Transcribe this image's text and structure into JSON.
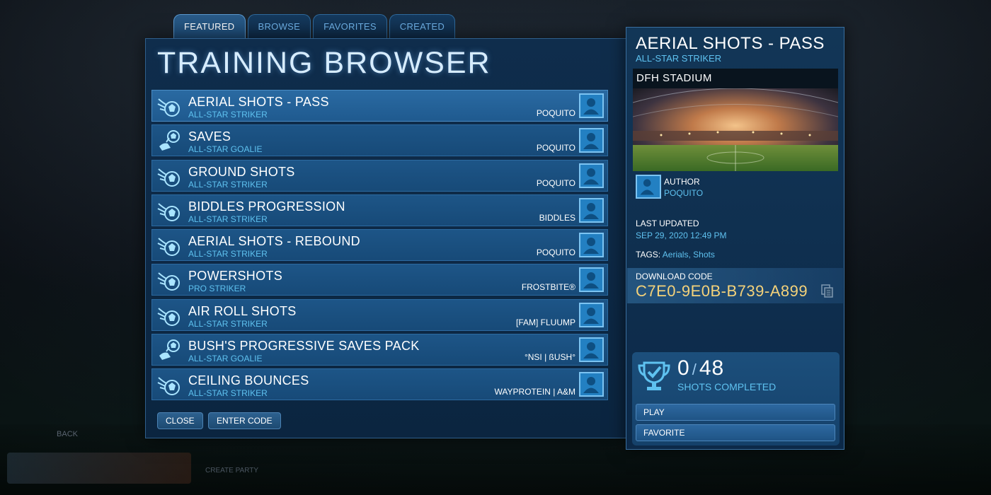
{
  "tabs": [
    {
      "label": "FEATURED",
      "active": true
    },
    {
      "label": "BROWSE",
      "active": false
    },
    {
      "label": "FAVORITES",
      "active": false
    },
    {
      "label": "CREATED",
      "active": false
    }
  ],
  "main": {
    "title": "TRAINING BROWSER",
    "rows": [
      {
        "name": "AERIAL SHOTS - PASS",
        "difficulty": "ALL-STAR STRIKER",
        "author": "POQUITO",
        "icon": "striker-icon"
      },
      {
        "name": "SAVES",
        "difficulty": "ALL-STAR GOALIE",
        "author": "POQUITO",
        "icon": "goalie-icon"
      },
      {
        "name": "GROUND SHOTS",
        "difficulty": "ALL-STAR STRIKER",
        "author": "POQUITO",
        "icon": "striker-icon"
      },
      {
        "name": "BIDDLES PROGRESSION",
        "difficulty": "ALL-STAR STRIKER",
        "author": "BIDDLES",
        "icon": "striker-icon"
      },
      {
        "name": "AERIAL SHOTS - REBOUND",
        "difficulty": "ALL-STAR STRIKER",
        "author": "POQUITO",
        "icon": "striker-icon"
      },
      {
        "name": "POWERSHOTS",
        "difficulty": "PRO STRIKER",
        "author": "FROSTBITE®",
        "icon": "striker-icon"
      },
      {
        "name": "AIR ROLL SHOTS",
        "difficulty": "ALL-STAR STRIKER",
        "author": "[FAM] FLUUMP",
        "icon": "striker-icon"
      },
      {
        "name": "BUSH'S PROGRESSIVE SAVES PACK",
        "difficulty": "ALL-STAR GOALIE",
        "author": "°NSI | ßUSH°",
        "icon": "goalie-icon"
      },
      {
        "name": "CEILING BOUNCES",
        "difficulty": "ALL-STAR STRIKER",
        "author": "WAYPROTEIN | A&M",
        "icon": "striker-icon"
      }
    ],
    "close_label": "CLOSE",
    "enter_code_label": "ENTER CODE"
  },
  "detail": {
    "title": "AERIAL SHOTS - PASS",
    "difficulty": "ALL-STAR STRIKER",
    "arena": "DFH STADIUM",
    "author_label": "AUTHOR",
    "author": "POQUITO",
    "updated_label": "LAST UPDATED",
    "updated": "SEP 29, 2020 12:49 PM",
    "tags_label": "TAGS:",
    "tags": "Aerials, Shots",
    "code_label": "DOWNLOAD CODE",
    "code": "C7E0-9E0B-B739-A899",
    "completed": "0",
    "total": "48",
    "count_sep": "/",
    "shots_label": "SHOTS COMPLETED",
    "play_label": "PLAY",
    "favorite_label": "FAVORITE"
  },
  "background": {
    "back_label": "BACK",
    "party_label": "CREATE PARTY"
  },
  "colors": {
    "accent": "#5fc2f0",
    "code": "#f4d27a",
    "panel": "#0f2d4c"
  }
}
